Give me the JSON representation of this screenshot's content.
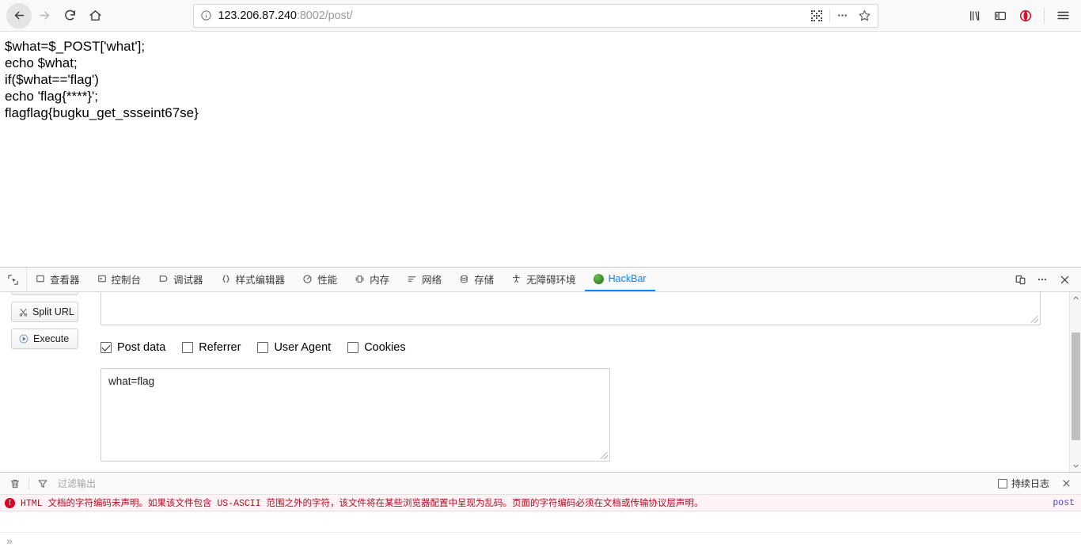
{
  "browser": {
    "nav": {
      "back_label": "Back",
      "forward_label": "Forward",
      "reload_label": "Reload",
      "home_label": "Home"
    },
    "url": {
      "host": "123.206.87.240",
      "path": ":8002/post/",
      "full": "123.206.87.240:8002/post/",
      "identity_icon": "info-circle-icon"
    },
    "url_tools": {
      "qr_label": "qr-code-icon",
      "more_label": "page-actions-icon",
      "bookmark_label": "star-icon"
    },
    "toolbar_right": {
      "library_label": "library-icon",
      "sidebar_label": "sidebar-icon",
      "extension_label": "opera-extension-icon",
      "menu_label": "hamburger-menu-icon"
    }
  },
  "page": {
    "lines": [
      "$what=$_POST['what'];",
      "echo $what;",
      "if($what=='flag')",
      "echo 'flag{****}';",
      "flagflag{bugku_get_ssseint67se}"
    ]
  },
  "devtools": {
    "picker_label": "element-picker-icon",
    "tabs": [
      {
        "label": "查看器",
        "icon": "inspector-icon",
        "active": false
      },
      {
        "label": "控制台",
        "icon": "console-icon",
        "active": false
      },
      {
        "label": "调试器",
        "icon": "debugger-icon",
        "active": false
      },
      {
        "label": "样式编辑器",
        "icon": "style-editor-icon",
        "active": false
      },
      {
        "label": "性能",
        "icon": "performance-icon",
        "active": false
      },
      {
        "label": "内存",
        "icon": "memory-icon",
        "active": false
      },
      {
        "label": "网络",
        "icon": "network-icon",
        "active": false
      },
      {
        "label": "存储",
        "icon": "storage-icon",
        "active": false
      },
      {
        "label": "无障碍环境",
        "icon": "accessibility-icon",
        "active": false
      },
      {
        "label": "HackBar",
        "icon": "hackbar-icon",
        "active": true
      }
    ],
    "right_buttons": {
      "responsive_label": "responsive-design-mode-icon",
      "more_label": "devtools-options-icon",
      "close_label": "close-devtools-icon"
    },
    "active_tab_color": "#0a84ff"
  },
  "hackbar": {
    "buttons": [
      {
        "label": "Split URL",
        "accel": "p",
        "icon": "scissors-icon"
      },
      {
        "label": "Execute",
        "accel": "E",
        "icon": "play-icon"
      }
    ],
    "url_value": "",
    "checkboxes": [
      {
        "label": "Post data",
        "checked": true
      },
      {
        "label": "Referrer",
        "checked": false
      },
      {
        "label": "User Agent",
        "checked": false
      },
      {
        "label": "Cookies",
        "checked": false
      }
    ],
    "post_data_value": "what=flag",
    "scrollbar": {
      "up_icon": "chevron-up-icon",
      "down_icon": "chevron-down-icon"
    }
  },
  "console": {
    "toolbar": {
      "clear_icon": "trash-icon",
      "filter_icon": "funnel-icon",
      "filter_placeholder": "过滤输出",
      "persist_label": "持续日志",
      "persist_checked": false,
      "close_icon": "close-icon"
    },
    "messages": [
      {
        "level": "error",
        "text": "HTML 文档的字符编码未声明。如果该文件包含 US-ASCII 范围之外的字符，该文件将在某些浏览器配置中呈现为乱码。页面的字符编码必须在文档或传输协议层声明。",
        "source": "post"
      }
    ],
    "prompt": "»"
  }
}
